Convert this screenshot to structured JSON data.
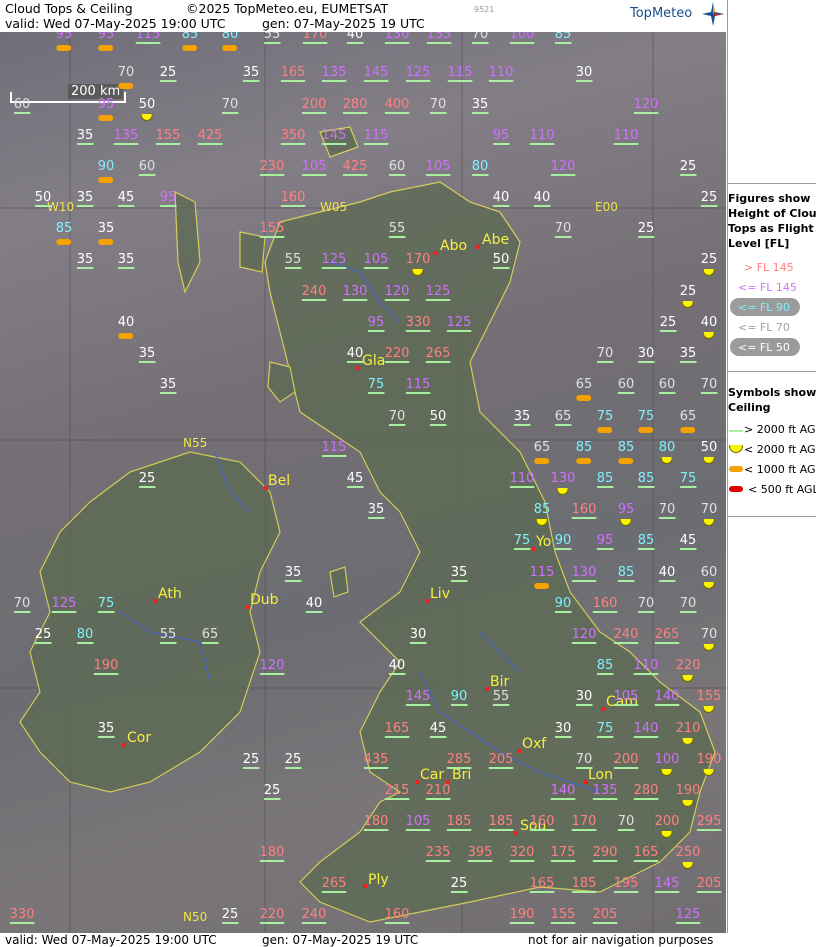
{
  "header": {
    "title": "Cloud Tops & Ceiling",
    "copyright": "©2025 TopMeteo.eu, EUMETSAT",
    "valid": "valid:  Wed  07-May-2025  19:00 UTC",
    "gen": "gen: 07-May-2025 19 UTC",
    "code": "9521",
    "logo": "TopMeteo"
  },
  "footer": {
    "valid": "valid:  Wed  07-May-2025  19:00 UTC",
    "gen": "gen: 07-May-2025 19 UTC",
    "note": "not for air navigation purposes"
  },
  "scale_label": "200 km",
  "grid_labels": [
    "W10",
    "W05",
    "E00",
    "N55",
    "N50"
  ],
  "cities": [
    "Abo",
    "Abe",
    "Gla",
    "Bel",
    "Ath",
    "Dub",
    "Liv",
    "Yo",
    "Bir",
    "Cam",
    "Cor",
    "Oxf",
    "Car",
    "Bri",
    "Lon",
    "Sou",
    "Ply"
  ],
  "legend": {
    "figures_title": [
      "Figures show",
      "Height of Cloud",
      "Tops as Flight",
      "Level  [FL]"
    ],
    "levels": [
      "> FL 145",
      "<= FL 145",
      "<= FL 90",
      "<= FL 70",
      "<= FL 50"
    ],
    "symbols_title": [
      "Symbols show",
      "Ceiling"
    ],
    "ceilings": [
      "> 2000 ft AGL",
      "< 2000 ft AGL",
      "< 1000 ft AGL",
      "< 500 ft AGL"
    ]
  },
  "colors": {
    "fl_gt145": "#ff8080",
    "fl_le145": "#d070ff",
    "fl_le90": "#80f0ff",
    "fl_le70": "#e0e0e0",
    "fl_le50": "#ffffff",
    "ceil_gt2000": "#a8f0a0",
    "ceil_lt2000": "#fdf300",
    "ceil_lt1000": "#f5a100",
    "ceil_lt500": "#e00000",
    "coast": "#f2ea50",
    "river": "#4060e0"
  },
  "cloud_tops": [
    {
      "v": "95",
      "c": "o"
    },
    {
      "v": "95",
      "c": "o"
    },
    {
      "v": "115",
      "c": "g"
    },
    {
      "v": "85",
      "c": "o"
    },
    {
      "v": "80",
      "c": "o"
    },
    {
      "v": "55",
      "c": "g"
    },
    {
      "v": "170",
      "c": "g"
    },
    {
      "v": "40",
      "c": "g"
    },
    {
      "v": "130",
      "c": "g"
    },
    {
      "v": "135",
      "c": "g"
    },
    {
      "v": "70",
      "c": "g"
    },
    {
      "v": "100",
      "c": "g"
    },
    {
      "v": "85",
      "c": "g"
    },
    {
      "v": "70",
      "c": "o"
    },
    {
      "v": "25",
      "c": "g"
    },
    {
      "v": "35",
      "c": "g"
    },
    {
      "v": "165",
      "c": "g"
    },
    {
      "v": "135",
      "c": "g"
    },
    {
      "v": "145",
      "c": "g"
    },
    {
      "v": "125",
      "c": "g"
    },
    {
      "v": "115",
      "c": "g"
    },
    {
      "v": "110",
      "c": "g"
    },
    {
      "v": "30",
      "c": "g"
    },
    {
      "v": "60",
      "c": "g"
    },
    {
      "v": "95",
      "c": "o"
    },
    {
      "v": "50",
      "c": "y"
    },
    {
      "v": "70",
      "c": "g"
    },
    {
      "v": "200",
      "c": "g"
    },
    {
      "v": "280",
      "c": "g"
    },
    {
      "v": "400",
      "c": "g"
    },
    {
      "v": "70",
      "c": "g"
    },
    {
      "v": "35",
      "c": "g"
    },
    {
      "v": "120",
      "c": "g"
    },
    {
      "v": "35",
      "c": "g"
    },
    {
      "v": "135",
      "c": "g"
    },
    {
      "v": "155",
      "c": "g"
    },
    {
      "v": "425",
      "c": "g"
    },
    {
      "v": "350",
      "c": "g"
    },
    {
      "v": "145",
      "c": "g"
    },
    {
      "v": "115",
      "c": "g"
    },
    {
      "v": "95",
      "c": "g"
    },
    {
      "v": "110",
      "c": "g"
    },
    {
      "v": "110",
      "c": "g"
    },
    {
      "v": "90",
      "c": "o"
    },
    {
      "v": "60",
      "c": "g"
    },
    {
      "v": "230",
      "c": "g"
    },
    {
      "v": "105",
      "c": "g"
    },
    {
      "v": "425",
      "c": "g"
    },
    {
      "v": "60",
      "c": "g"
    },
    {
      "v": "105",
      "c": "g"
    },
    {
      "v": "80",
      "c": "g"
    },
    {
      "v": "120",
      "c": "g"
    },
    {
      "v": "25",
      "c": "g"
    },
    {
      "v": "50",
      "c": "g"
    },
    {
      "v": "35",
      "c": "g"
    },
    {
      "v": "45",
      "c": "g"
    },
    {
      "v": "95",
      "c": "g"
    },
    {
      "v": "160",
      "c": "g"
    },
    {
      "v": "40",
      "c": "g"
    },
    {
      "v": "40",
      "c": "g"
    },
    {
      "v": "25",
      "c": "g"
    },
    {
      "v": "85",
      "c": "o"
    },
    {
      "v": "35",
      "c": "o"
    },
    {
      "v": "155",
      "c": "g"
    },
    {
      "v": "55",
      "c": "g"
    },
    {
      "v": "70",
      "c": "g"
    },
    {
      "v": "25",
      "c": "g"
    },
    {
      "v": "35",
      "c": "g"
    },
    {
      "v": "35",
      "c": "g"
    },
    {
      "v": "55",
      "c": "g"
    },
    {
      "v": "125",
      "c": "g"
    },
    {
      "v": "105",
      "c": "g"
    },
    {
      "v": "170",
      "c": "y"
    },
    {
      "v": "50",
      "c": "g"
    },
    {
      "v": "25",
      "c": "y"
    },
    {
      "v": "240",
      "c": "g"
    },
    {
      "v": "130",
      "c": "g"
    },
    {
      "v": "120",
      "c": "g"
    },
    {
      "v": "125",
      "c": "g"
    },
    {
      "v": "25",
      "c": "y"
    },
    {
      "v": "40",
      "c": "o"
    },
    {
      "v": "95",
      "c": "g"
    },
    {
      "v": "330",
      "c": "g"
    },
    {
      "v": "125",
      "c": "g"
    },
    {
      "v": "25",
      "c": "g"
    },
    {
      "v": "40",
      "c": "y"
    },
    {
      "v": "35",
      "c": "g"
    },
    {
      "v": "40",
      "c": "g"
    },
    {
      "v": "220",
      "c": "g"
    },
    {
      "v": "265",
      "c": "g"
    },
    {
      "v": "70",
      "c": "g"
    },
    {
      "v": "30",
      "c": "g"
    },
    {
      "v": "35",
      "c": "g"
    },
    {
      "v": "35",
      "c": "g"
    },
    {
      "v": "75",
      "c": "g"
    },
    {
      "v": "115",
      "c": "g"
    },
    {
      "v": "65",
      "c": "o"
    },
    {
      "v": "60",
      "c": "g"
    },
    {
      "v": "60",
      "c": "g"
    },
    {
      "v": "70",
      "c": "g"
    },
    {
      "v": "70",
      "c": "g"
    },
    {
      "v": "50",
      "c": "g"
    },
    {
      "v": "35",
      "c": "g"
    },
    {
      "v": "65",
      "c": "g"
    },
    {
      "v": "75",
      "c": "o"
    },
    {
      "v": "75",
      "c": "o"
    },
    {
      "v": "65",
      "c": "o"
    },
    {
      "v": "115",
      "c": "g"
    },
    {
      "v": "65",
      "c": "o"
    },
    {
      "v": "85",
      "c": "o"
    },
    {
      "v": "85",
      "c": "o"
    },
    {
      "v": "80",
      "c": "y"
    },
    {
      "v": "50",
      "c": "y"
    },
    {
      "v": "25",
      "c": "g"
    },
    {
      "v": "45",
      "c": "g"
    },
    {
      "v": "110",
      "c": "g"
    },
    {
      "v": "130",
      "c": "y"
    },
    {
      "v": "85",
      "c": "g"
    },
    {
      "v": "85",
      "c": "g"
    },
    {
      "v": "75",
      "c": "g"
    },
    {
      "v": "35",
      "c": "g"
    },
    {
      "v": "85",
      "c": "y"
    },
    {
      "v": "160",
      "c": "g"
    },
    {
      "v": "95",
      "c": "y"
    },
    {
      "v": "70",
      "c": "g"
    },
    {
      "v": "70",
      "c": "y"
    },
    {
      "v": "75",
      "c": "g"
    },
    {
      "v": "90",
      "c": "g"
    },
    {
      "v": "95",
      "c": "g"
    },
    {
      "v": "85",
      "c": "g"
    },
    {
      "v": "45",
      "c": "g"
    },
    {
      "v": "35",
      "c": "g"
    },
    {
      "v": "35",
      "c": "g"
    },
    {
      "v": "115",
      "c": "o"
    },
    {
      "v": "130",
      "c": "g"
    },
    {
      "v": "85",
      "c": "g"
    },
    {
      "v": "40",
      "c": "g"
    },
    {
      "v": "60",
      "c": "y"
    },
    {
      "v": "70",
      "c": "g"
    },
    {
      "v": "125",
      "c": "g"
    },
    {
      "v": "75",
      "c": "g"
    },
    {
      "v": "40",
      "c": "g"
    },
    {
      "v": "90",
      "c": "g"
    },
    {
      "v": "160",
      "c": "g"
    },
    {
      "v": "70",
      "c": "g"
    },
    {
      "v": "70",
      "c": "g"
    },
    {
      "v": "25",
      "c": "g"
    },
    {
      "v": "80",
      "c": "g"
    },
    {
      "v": "55",
      "c": "g"
    },
    {
      "v": "65",
      "c": "g"
    },
    {
      "v": "30",
      "c": "g"
    },
    {
      "v": "120",
      "c": "g"
    },
    {
      "v": "240",
      "c": "g"
    },
    {
      "v": "265",
      "c": "g"
    },
    {
      "v": "70",
      "c": "y"
    },
    {
      "v": "190",
      "c": "g"
    },
    {
      "v": "120",
      "c": "g"
    },
    {
      "v": "40",
      "c": "g"
    },
    {
      "v": "85",
      "c": "g"
    },
    {
      "v": "110",
      "c": "g"
    },
    {
      "v": "220",
      "c": "y"
    },
    {
      "v": "145",
      "c": "g"
    },
    {
      "v": "90",
      "c": "g"
    },
    {
      "v": "55",
      "c": "g"
    },
    {
      "v": "30",
      "c": "g"
    },
    {
      "v": "105",
      "c": "g"
    },
    {
      "v": "140",
      "c": "g"
    },
    {
      "v": "155",
      "c": "y"
    },
    {
      "v": "35",
      "c": "g"
    },
    {
      "v": "165",
      "c": "g"
    },
    {
      "v": "45",
      "c": "g"
    },
    {
      "v": "30",
      "c": "g"
    },
    {
      "v": "75",
      "c": "g"
    },
    {
      "v": "140",
      "c": "g"
    },
    {
      "v": "210",
      "c": "y"
    },
    {
      "v": "25",
      "c": "g"
    },
    {
      "v": "25",
      "c": "g"
    },
    {
      "v": "435",
      "c": "g"
    },
    {
      "v": "285",
      "c": "g"
    },
    {
      "v": "205",
      "c": "g"
    },
    {
      "v": "70",
      "c": "g"
    },
    {
      "v": "200",
      "c": "g"
    },
    {
      "v": "100",
      "c": "y"
    },
    {
      "v": "190",
      "c": "y"
    },
    {
      "v": "25",
      "c": "g"
    },
    {
      "v": "215",
      "c": "g"
    },
    {
      "v": "210",
      "c": "g"
    },
    {
      "v": "140",
      "c": "g"
    },
    {
      "v": "135",
      "c": "g"
    },
    {
      "v": "280",
      "c": "g"
    },
    {
      "v": "190",
      "c": "y"
    },
    {
      "v": "180",
      "c": "g"
    },
    {
      "v": "105",
      "c": "g"
    },
    {
      "v": "185",
      "c": "g"
    },
    {
      "v": "185",
      "c": "g"
    },
    {
      "v": "160",
      "c": "g"
    },
    {
      "v": "170",
      "c": "g"
    },
    {
      "v": "70",
      "c": "g"
    },
    {
      "v": "200",
      "c": "y"
    },
    {
      "v": "295",
      "c": "g"
    },
    {
      "v": "180",
      "c": "g"
    },
    {
      "v": "235",
      "c": "g"
    },
    {
      "v": "395",
      "c": "g"
    },
    {
      "v": "320",
      "c": "g"
    },
    {
      "v": "175",
      "c": "g"
    },
    {
      "v": "290",
      "c": "g"
    },
    {
      "v": "165",
      "c": "g"
    },
    {
      "v": "250",
      "c": "y"
    },
    {
      "v": "265",
      "c": "g"
    },
    {
      "v": "25",
      "c": "g"
    },
    {
      "v": "165",
      "c": "g"
    },
    {
      "v": "185",
      "c": "g"
    },
    {
      "v": "195",
      "c": "g"
    },
    {
      "v": "145",
      "c": "g"
    },
    {
      "v": "205",
      "c": "g"
    },
    {
      "v": "330",
      "c": "g"
    },
    {
      "v": "25",
      "c": "g"
    },
    {
      "v": "220",
      "c": "g"
    },
    {
      "v": "240",
      "c": "g"
    },
    {
      "v": "160",
      "c": "g"
    },
    {
      "v": "190",
      "c": "g"
    },
    {
      "v": "155",
      "c": "g"
    },
    {
      "v": "205",
      "c": "g"
    },
    {
      "v": "125",
      "c": "g"
    }
  ]
}
